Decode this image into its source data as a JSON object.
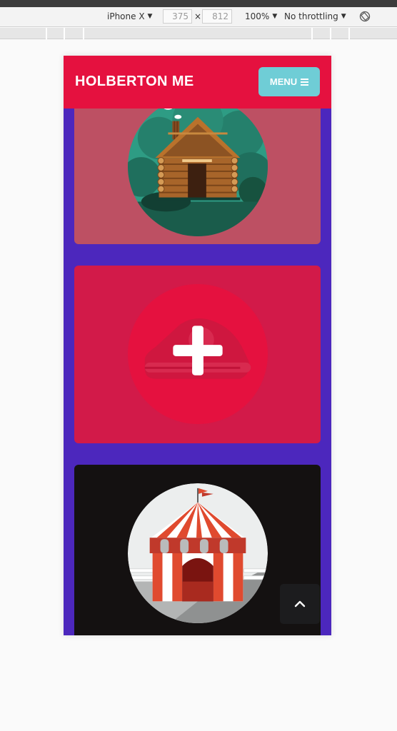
{
  "devtools": {
    "device": "iPhone X",
    "width": "375",
    "height": "812",
    "separator": "×",
    "zoom": "100%",
    "throttling": "No throttling"
  },
  "header": {
    "brand": "HOLBERTON ME",
    "menu_label": "MENU"
  },
  "cards": [
    {
      "illustration": "log-cabin"
    },
    {
      "illustration": "add-pin"
    },
    {
      "illustration": "circus-tent"
    }
  ],
  "colors": {
    "header": "#e5113f",
    "page_bg": "#4c27bd",
    "menu_button": "#6fcdd6",
    "card_cabin": "#bd5063",
    "card_add": "#d21a49",
    "card_tent": "#141111"
  },
  "icons": {
    "menu": "hamburger-icon",
    "scroll_top": "chevron-up-icon",
    "rotate": "rotate-icon"
  }
}
